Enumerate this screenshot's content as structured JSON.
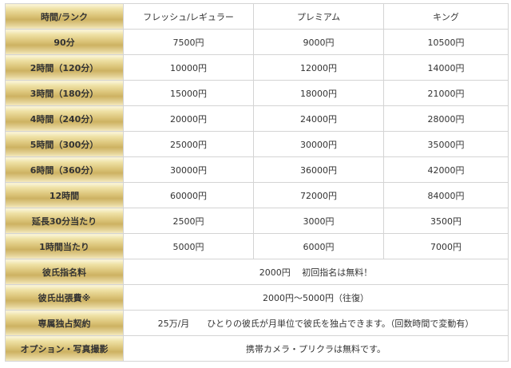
{
  "table": {
    "corner_label": "時間/ランク",
    "columns": [
      "フレッシュ/レギュラー",
      "プレミアム",
      "キング"
    ],
    "rows": [
      {
        "label": "90分",
        "values": [
          "7500円",
          "9000円",
          "10500円"
        ]
      },
      {
        "label": "2時間（120分）",
        "values": [
          "10000円",
          "12000円",
          "14000円"
        ]
      },
      {
        "label": "3時間（180分）",
        "values": [
          "15000円",
          "18000円",
          "21000円"
        ]
      },
      {
        "label": "4時間（240分）",
        "values": [
          "20000円",
          "24000円",
          "28000円"
        ]
      },
      {
        "label": "5時間（300分）",
        "values": [
          "25000円",
          "30000円",
          "35000円"
        ]
      },
      {
        "label": "6時間（360分）",
        "values": [
          "30000円",
          "36000円",
          "42000円"
        ]
      },
      {
        "label": "12時間",
        "values": [
          "60000円",
          "72000円",
          "84000円"
        ]
      },
      {
        "label": "延長30分当たり",
        "values": [
          "2500円",
          "3000円",
          "3500円"
        ]
      },
      {
        "label": "1時間当たり",
        "values": [
          "5000円",
          "6000円",
          "7000円"
        ]
      }
    ],
    "extras": [
      {
        "label": "彼氏指名料",
        "text": "2000円　 初回指名は無料！"
      },
      {
        "label": "彼氏出張費※",
        "text": "2000円～5000円（往復）"
      },
      {
        "label": "専属独占契約",
        "text": "25万/月　　ひとりの彼氏が月単位で彼氏を独占できます。（回数時間で変動有）"
      },
      {
        "label": "オプション・写真撮影",
        "text": "携帯カメラ・プリクラは無料です。"
      }
    ]
  }
}
